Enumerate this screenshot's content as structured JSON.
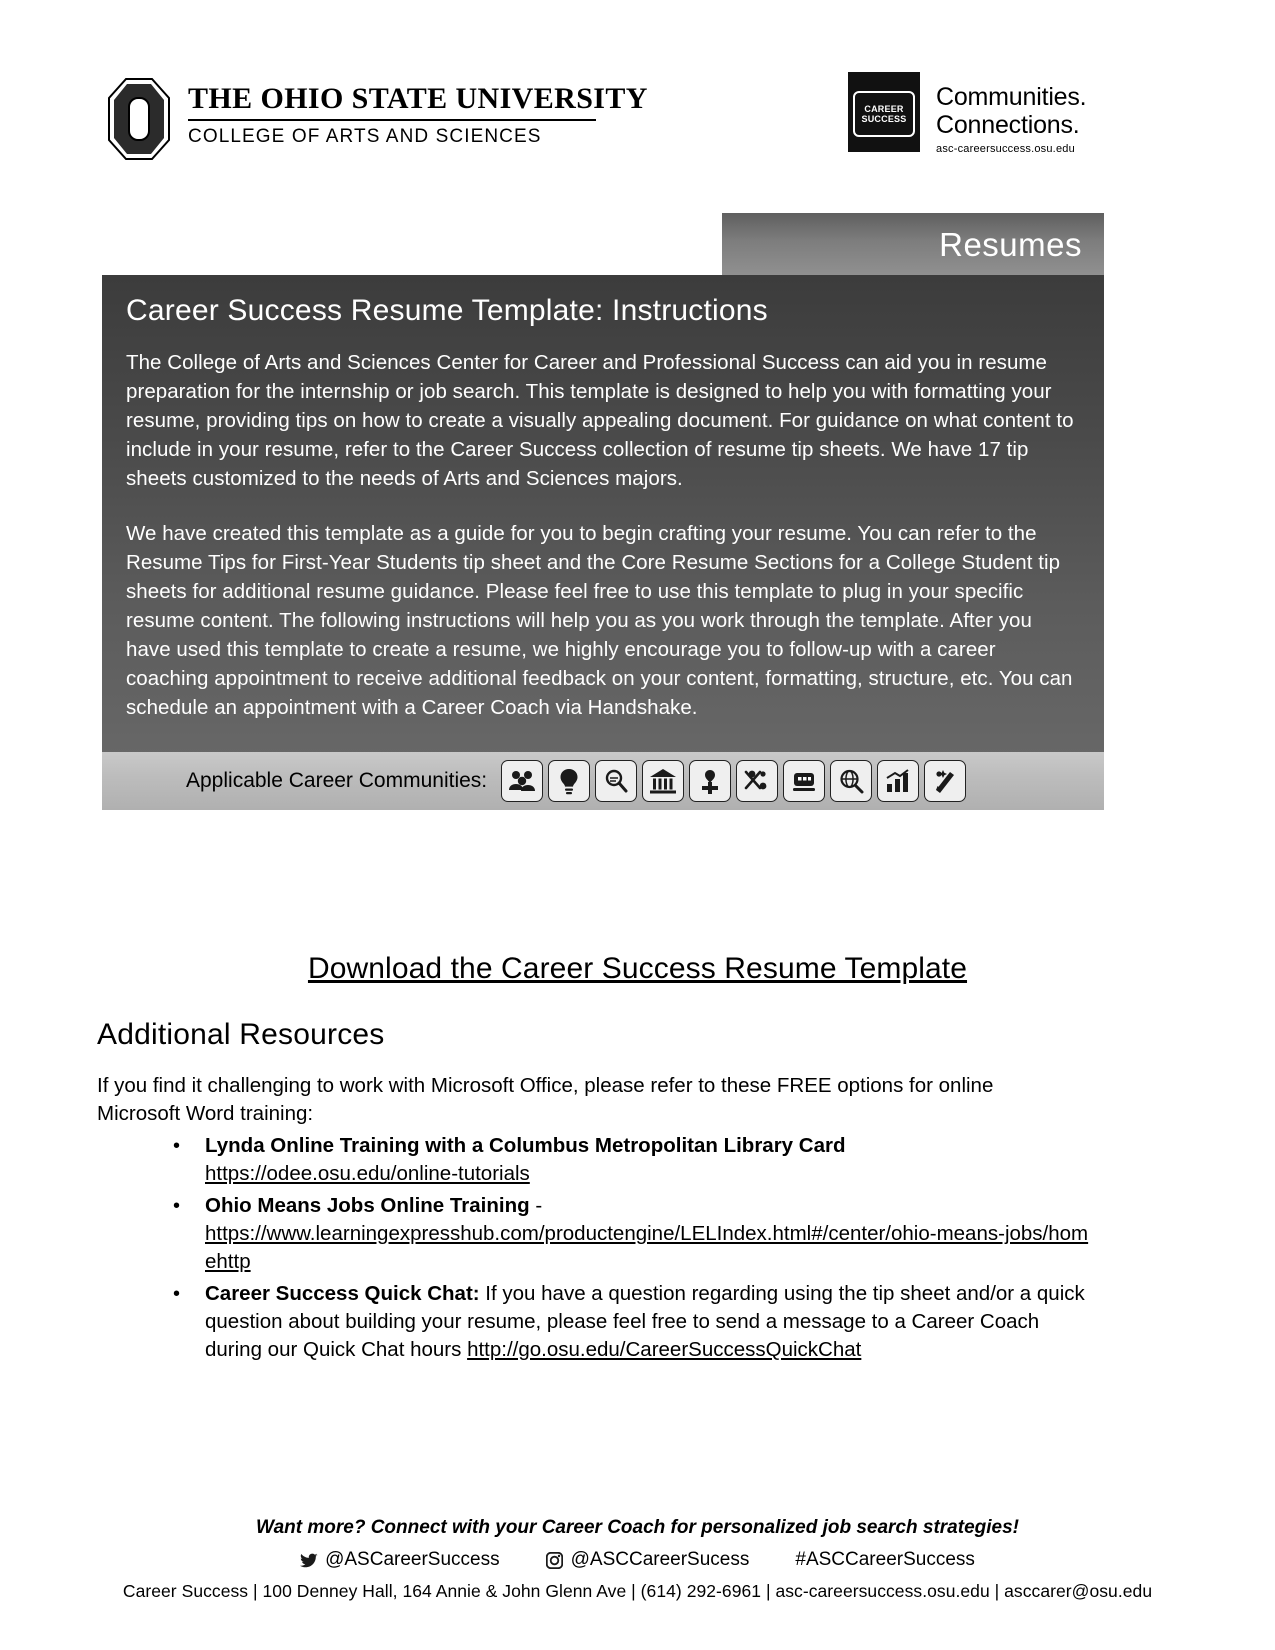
{
  "header": {
    "university_name": "THE OHIO STATE UNIVERSITY",
    "college_name": "COLLEGE OF ARTS AND SCIENCES",
    "badge_line1": "CAREER",
    "badge_line2": "SUCCESS",
    "brand_line1": "Communities.",
    "brand_line2": "Connections.",
    "brand_url": "asc-careersuccess.osu.edu"
  },
  "tab": {
    "label": "Resumes"
  },
  "panel": {
    "title": "Career Success Resume Template: Instructions",
    "paragraph1": "The College of Arts and Sciences Center for Career and Professional Success can aid you in resume preparation for the internship or job search. This template is designed to help you with formatting your resume, providing tips on how to create a visually appealing document. For guidance on what content to include in your resume, refer to the Career Success collection of resume tip sheets.  We have 17 tip sheets customized to the needs of Arts and Sciences majors.",
    "paragraph2": "We have created this template as a guide for you to begin crafting your resume. You can refer to the Resume Tips for First-Year Students tip sheet and the Core Resume Sections for a College Student tip sheets for additional resume guidance. Please feel free to use this template to plug in your specific resume content. The following instructions will help you as you work through the template. After you have used this template to create a resume, we highly encourage you to follow-up with a career coaching appointment to receive additional feedback on your content, formatting, structure, etc. You can schedule an appointment with a Career Coach via Handshake.",
    "communities_label": "Applicable Career Communities:",
    "community_icons": [
      "people-group-icon",
      "lightbulb-icon",
      "magnifier-book-icon",
      "bank-building-icon",
      "health-cross-icon",
      "gears-people-icon",
      "microscope-icon",
      "globe-search-icon",
      "chart-growth-icon",
      "arts-palette-icon"
    ]
  },
  "download": {
    "label": "Download the Career Success Resume Template"
  },
  "resources": {
    "heading": "Additional Resources",
    "intro": "If you find it challenging to work with Microsoft Office, please refer to these FREE options for online Microsoft Word training:",
    "items": [
      {
        "title": "Lynda Online Training with a Columbus Metropolitan Library Card",
        "suffix": "",
        "body": "",
        "link": "https://odee.osu.edu/online-tutorials",
        "link_trailing": ""
      },
      {
        "title": "Ohio Means Jobs Online Training",
        "suffix": " -",
        "body": "",
        "link": "https://www.learningexpresshub.com/productengine/LELIndex.html#/center/ohio-means-jobs/homehttp",
        "link_trailing": ""
      },
      {
        "title": "Career Success Quick Chat:",
        "suffix": "",
        "body": " If you have a question regarding using the tip sheet and/or a quick question about building your resume, please feel free to send a message to a Career Coach during our Quick Chat hours ",
        "link": "http://go.osu.edu/CareerSuccessQuickChat",
        "link_trailing": ""
      }
    ]
  },
  "footer": {
    "tagline": "Want more? Connect with your Career Coach for personalized job search strategies!",
    "social": [
      {
        "icon": "twitter-bird-icon",
        "handle": "@ASCareerSuccess"
      },
      {
        "icon": "instagram-icon",
        "handle": "@ASCCareerSucess"
      },
      {
        "icon": "",
        "handle": "#ASCCareerSuccess"
      }
    ],
    "contact": "Career Success | 100 Denney Hall, 164 Annie & John Glenn Ave | (614) 292-6961 | asc-careersuccess.osu.edu | asccarer@osu.edu"
  }
}
